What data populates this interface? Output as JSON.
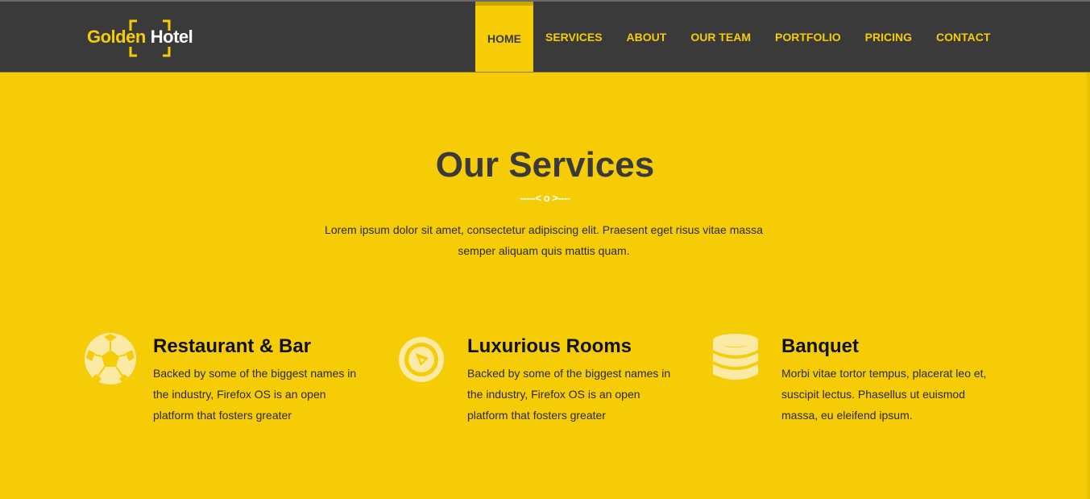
{
  "colors": {
    "accent": "#f5cc05",
    "navbar": "#3a3a3a",
    "heading": "#3a3a3a",
    "icon_fill": "#fbe9a6"
  },
  "brand": {
    "golden": "Golden",
    "hotel": "Hotel"
  },
  "nav": {
    "items": [
      {
        "label": "HOME",
        "active": true
      },
      {
        "label": "SERVICES",
        "active": false
      },
      {
        "label": "ABOUT",
        "active": false
      },
      {
        "label": "OUR TEAM",
        "active": false
      },
      {
        "label": "PORTFOLIO",
        "active": false
      },
      {
        "label": "PRICING",
        "active": false
      },
      {
        "label": "CONTACT",
        "active": false
      }
    ]
  },
  "services_section": {
    "title": "Our Services",
    "divider": "-----< o >----",
    "description": "Lorem ipsum dolor sit amet, consectetur adipiscing elit. Praesent eget risus vitae massa semper aliquam quis mattis quam.",
    "items": [
      {
        "icon": "soccer-ball-icon",
        "title": "Restaurant & Bar",
        "text": "Backed by some of the biggest names in the industry, Firefox OS is an open platform that fosters greater"
      },
      {
        "icon": "play-circle-icon",
        "title": "Luxurious Rooms",
        "text": "Backed by some of the biggest names in the industry, Firefox OS is an open platform that fosters greater"
      },
      {
        "icon": "coin-stack-icon",
        "title": "Banquet",
        "text": "Morbi vitae tortor tempus, placerat leo et, suscipit lectus. Phasellus ut euismod massa, eu eleifend ipsum."
      }
    ]
  }
}
